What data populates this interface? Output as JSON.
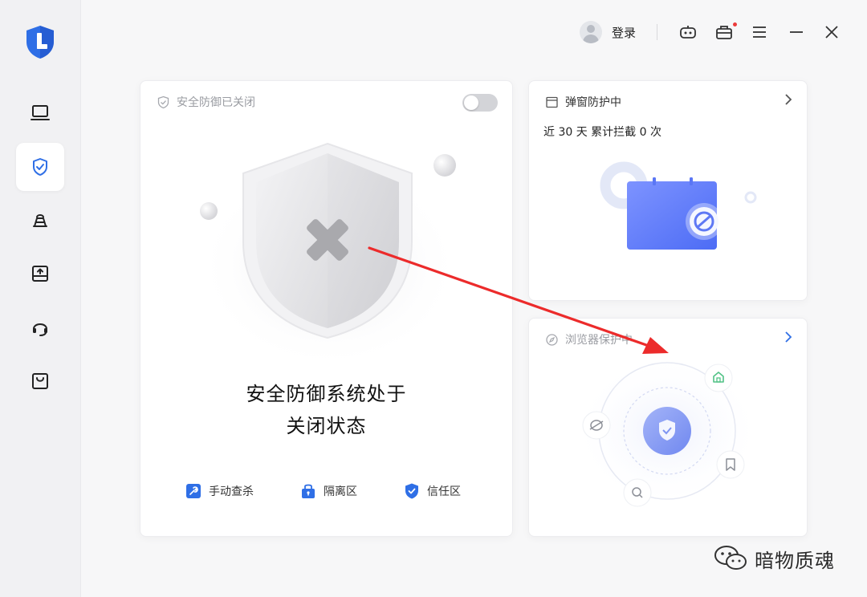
{
  "app": {
    "logo_icon": "app-logo",
    "brand_color": "#2f6fe6"
  },
  "sidebar": {
    "items": [
      {
        "icon": "monitor-icon",
        "active": false
      },
      {
        "icon": "shield-check-icon",
        "active": true
      },
      {
        "icon": "tools-icon",
        "active": false
      },
      {
        "icon": "upload-box-icon",
        "active": false
      },
      {
        "icon": "headset-icon",
        "active": false
      },
      {
        "icon": "bag-icon",
        "active": false
      }
    ]
  },
  "topbar": {
    "login_label": "登录",
    "icons": [
      "robot-icon",
      "toolbox-icon",
      "menu-icon",
      "minimize-icon",
      "close-icon"
    ],
    "notification_dot_color": "#ec3b3b"
  },
  "main_card": {
    "header_label": "安全防御已关闭",
    "toggle_on": false,
    "status_line1": "安全防御系统处于",
    "status_line2": "关闭状态",
    "actions": [
      {
        "label": "手动查杀",
        "icon": "wrench-icon"
      },
      {
        "label": "隔离区",
        "icon": "lock-box-icon"
      },
      {
        "label": "信任区",
        "icon": "shield-check-icon"
      }
    ]
  },
  "popup_card": {
    "header_label": "弹窗防护中",
    "count_text": "近 30 天 累计拦截 0 次"
  },
  "browser_card": {
    "header_label": "浏览器保护中"
  },
  "watermark": {
    "text": "暗物质魂"
  }
}
